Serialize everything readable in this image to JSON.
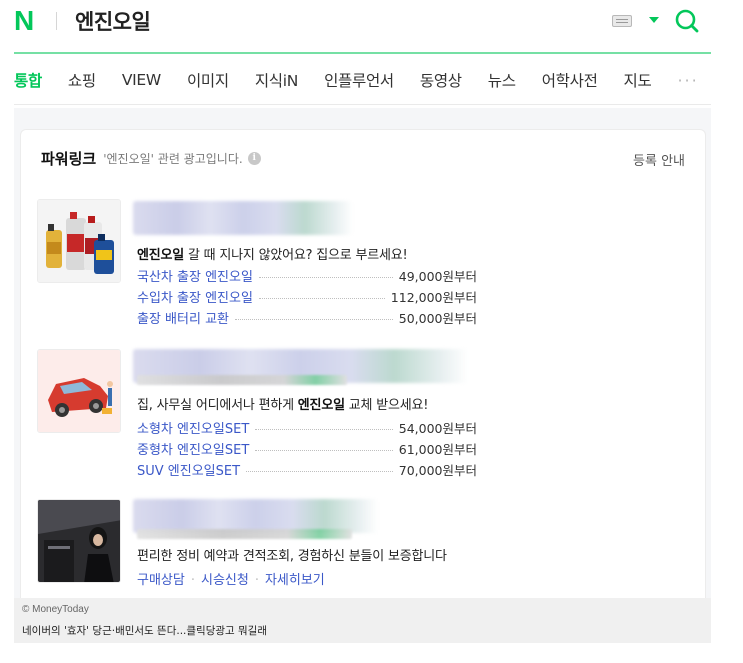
{
  "header": {
    "logo": "N",
    "query": "엔진오일",
    "icons": {
      "keyboard": "keyboard-icon",
      "dropdown": "caret-down-icon",
      "search": "search-icon"
    },
    "brand_color": "#03c75a"
  },
  "tabs": [
    {
      "label": "통합",
      "active": true
    },
    {
      "label": "쇼핑"
    },
    {
      "label": "VIEW"
    },
    {
      "label": "이미지"
    },
    {
      "label": "지식iN"
    },
    {
      "label": "인플루언서"
    },
    {
      "label": "동영상"
    },
    {
      "label": "뉴스"
    },
    {
      "label": "어학사전"
    },
    {
      "label": "지도"
    }
  ],
  "tabs_more": "···",
  "powerlink": {
    "title": "파워링크",
    "description": "'엔진오일' 관련 광고입니다.",
    "register": "등록 안내"
  },
  "ads": [
    {
      "thumb": "engine-oil-bottles-image",
      "headline_bold": "엔진오일",
      "headline_rest": " 갈 때 지나지 않았어요? 집으로 부르세요!",
      "links": [
        {
          "label": "국산차 출장 엔진오일",
          "price": "49,000원부터"
        },
        {
          "label": "수입차 출장 엔진오일",
          "price": "112,000원부터"
        },
        {
          "label": "출장 배터리 교환",
          "price": "50,000원부터"
        }
      ]
    },
    {
      "thumb": "red-car-service-image",
      "headline_pre": "집, 사무실 어디에서나 편하게 ",
      "headline_bold": "엔진오일",
      "headline_post": " 교체 받으세요!",
      "links": [
        {
          "label": "소형차 엔진오일SET",
          "price": "54,000원부터"
        },
        {
          "label": "중형차 엔진오일SET",
          "price": "61,000원부터"
        },
        {
          "label": "SUV 엔진오일SET",
          "price": "70,000원부터"
        }
      ]
    },
    {
      "thumb": "woman-in-garage-image",
      "headline": "편리한 정비 예약과 견적조회, 경험하신 분들이 보증합니다",
      "sub_links": [
        "구매상담",
        "시승신청",
        "자세히보기"
      ]
    }
  ],
  "caption": {
    "source": "© MoneyToday",
    "text": "네이버의 '효자' 당근·배민서도 뜬다...클릭당광고 뭐길래"
  }
}
